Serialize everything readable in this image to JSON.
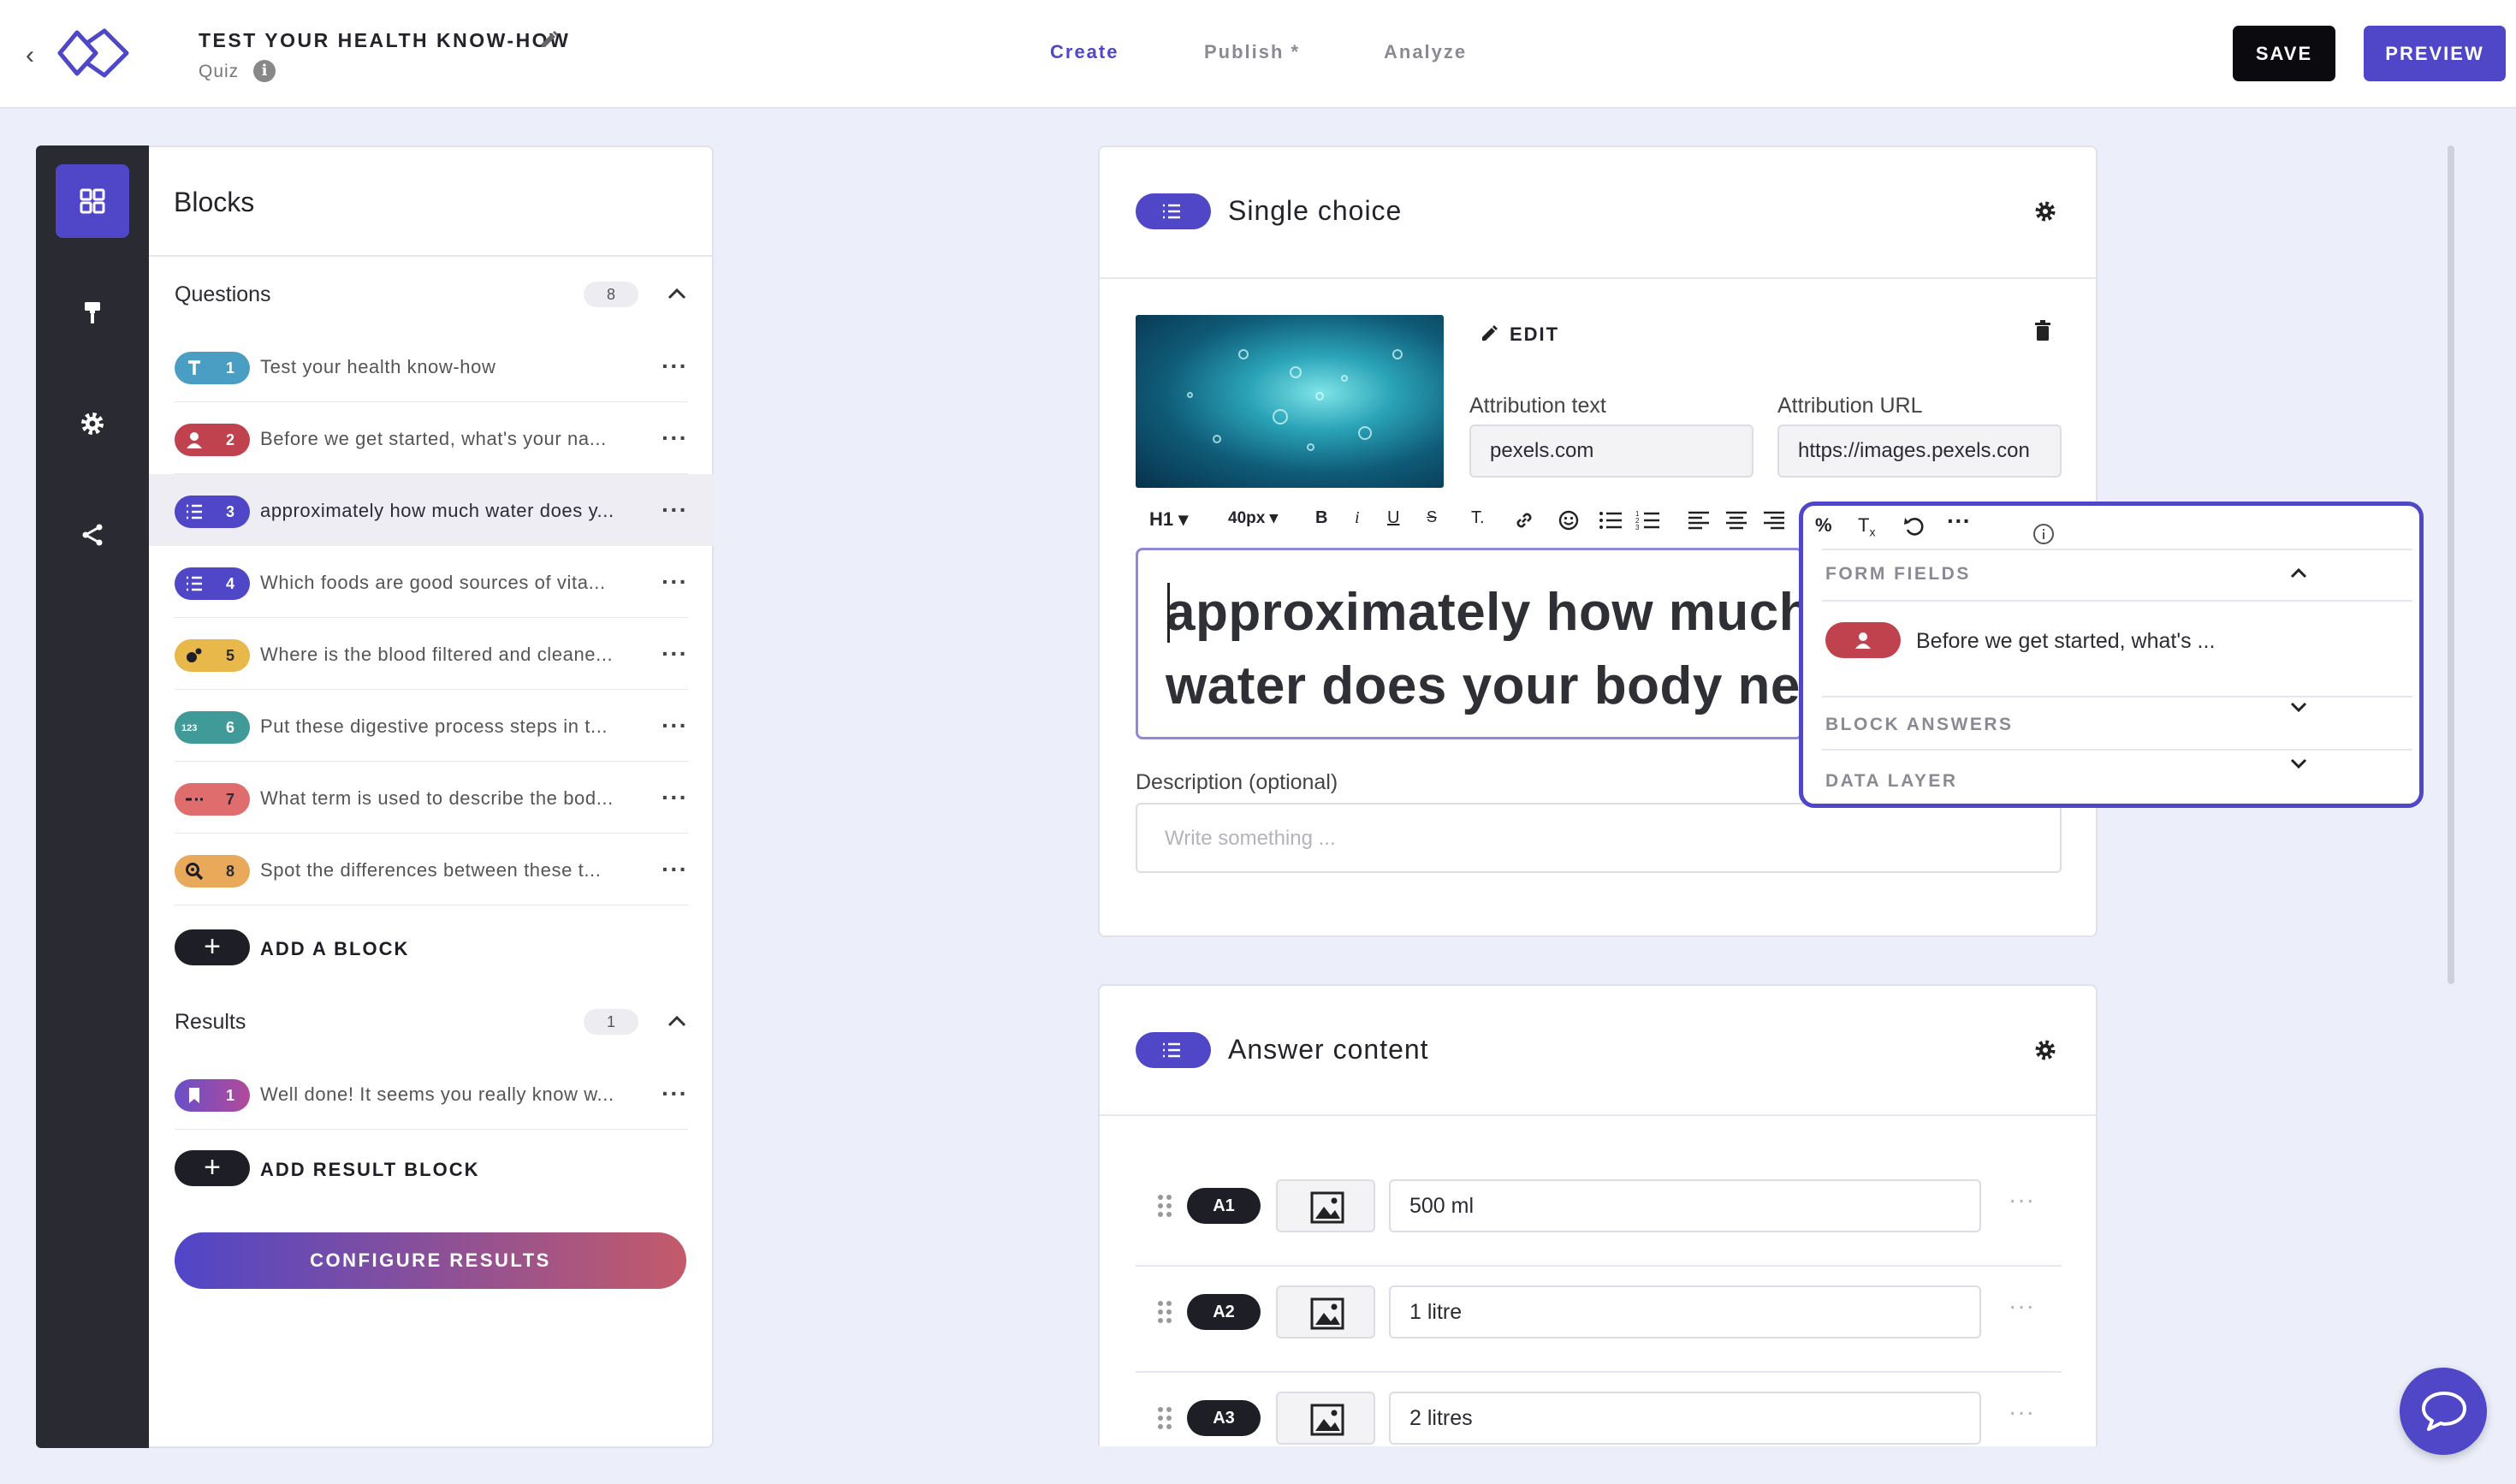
{
  "app": {
    "title": "TEST YOUR HEALTH KNOW-HOW",
    "subtitle": "Quiz",
    "back_icon": "chevron-left-icon",
    "logo_icon": "logo-icon"
  },
  "nav": {
    "tabs": [
      {
        "label": "Create",
        "active": true
      },
      {
        "label": "Publish *",
        "active": false
      },
      {
        "label": "Analyze",
        "active": false
      }
    ],
    "save_label": "SAVE",
    "preview_label": "PREVIEW"
  },
  "sidebar": {
    "rail": [
      "grid-icon",
      "paint-roller-icon",
      "gear-icon",
      "share-icon"
    ],
    "title": "Blocks",
    "questions": {
      "label": "Questions",
      "count": "8",
      "items": [
        {
          "num": "1",
          "icon": "text-icon",
          "color": "#4a9ec4",
          "text": "Test your health know-how"
        },
        {
          "num": "2",
          "icon": "user-icon",
          "color": "#c0424e",
          "text": "Before we get started, what's your na..."
        },
        {
          "num": "3",
          "icon": "list-icon",
          "color": "#4f46c8",
          "text": "approximately how much water does y..."
        },
        {
          "num": "4",
          "icon": "list-icon",
          "color": "#4f46c8",
          "text": "Which foods are good sources of vita..."
        },
        {
          "num": "5",
          "icon": "drag-drop-icon",
          "color": "#e8b84a",
          "text": "Where is the blood filtered and cleane..."
        },
        {
          "num": "6",
          "icon": "number-order-icon",
          "color": "#3f9a98",
          "text": "Put these digestive process steps in t..."
        },
        {
          "num": "7",
          "icon": "fill-blank-icon",
          "color": "#e06d6d",
          "text": "What term is used to describe the bod..."
        },
        {
          "num": "8",
          "icon": "magnify-icon",
          "color": "#e8a95a",
          "text": "Spot the differences between these t..."
        }
      ],
      "add_label": "ADD A BLOCK"
    },
    "results": {
      "label": "Results",
      "count": "1",
      "items": [
        {
          "num": "1",
          "icon": "bookmark-icon",
          "color": "#8a45b8",
          "text": "Well done! It seems you really know w..."
        }
      ],
      "add_label": "ADD RESULT BLOCK"
    },
    "configure_label": "CONFIGURE RESULTS"
  },
  "question_card": {
    "title": "Single choice",
    "edit_label": "EDIT",
    "attribution_text_label": "Attribution text",
    "attribution_text_value": "pexels.com",
    "attribution_url_label": "Attribution URL",
    "attribution_url_value": "https://images.pexels.con",
    "toolbar": {
      "heading": "H1",
      "size": "40px"
    },
    "title_text": "approximately how much water does your body need a day?",
    "description_label": "Description (optional)",
    "description_placeholder": "Write something ..."
  },
  "variables_popup": {
    "form_fields_label": "FORM FIELDS",
    "form_field_item": "Before we get started, what's ...",
    "block_answers_label": "BLOCK ANSWERS",
    "data_layer_label": "DATA LAYER"
  },
  "answer_card": {
    "title": "Answer content",
    "answers": [
      {
        "label": "A1",
        "value": "500 ml"
      },
      {
        "label": "A2",
        "value": "1 litre"
      },
      {
        "label": "A3",
        "value": "2 litres"
      }
    ]
  },
  "colors": {
    "accent": "#4f46c8",
    "dark": "#1e1e26",
    "rail": "#2a2a33"
  }
}
